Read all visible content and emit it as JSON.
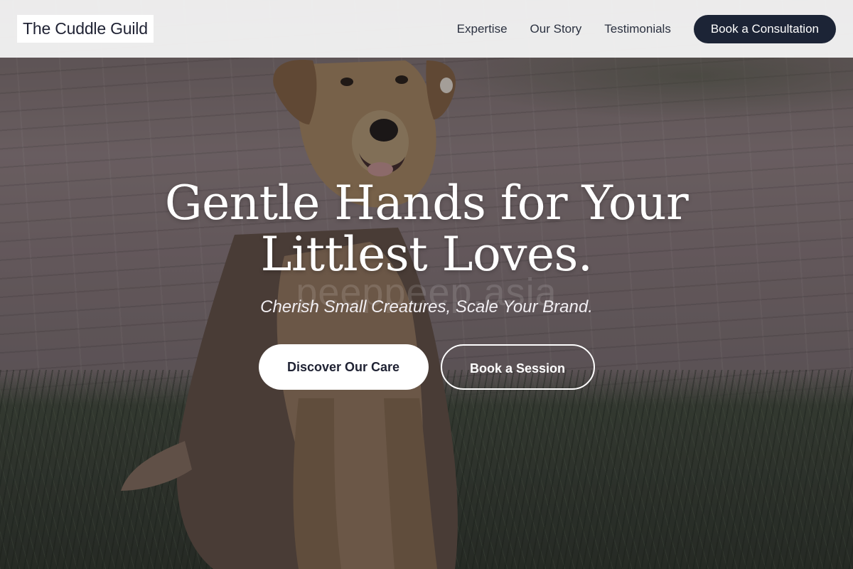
{
  "header": {
    "logo": "The Cuddle Guild",
    "nav": [
      {
        "label": "Expertise"
      },
      {
        "label": "Our Story"
      },
      {
        "label": "Testimonials"
      }
    ],
    "cta_label": "Book a Consultation"
  },
  "hero": {
    "headline_line1": "Gentle Hands for Your",
    "headline_line2": "Littlest Loves.",
    "watermark": "peeppeep.asia",
    "tagline": "Cherish Small Creatures, Scale Your Brand.",
    "primary_button": "Discover Our Care",
    "secondary_button": "Book a Session",
    "background_image": "dog sitting on brick pavement and grass"
  },
  "colors": {
    "header_bg": "#f5f5f5",
    "cta_bg": "#1c2436",
    "text_dark": "#1f2233",
    "hero_text": "#ffffff"
  }
}
